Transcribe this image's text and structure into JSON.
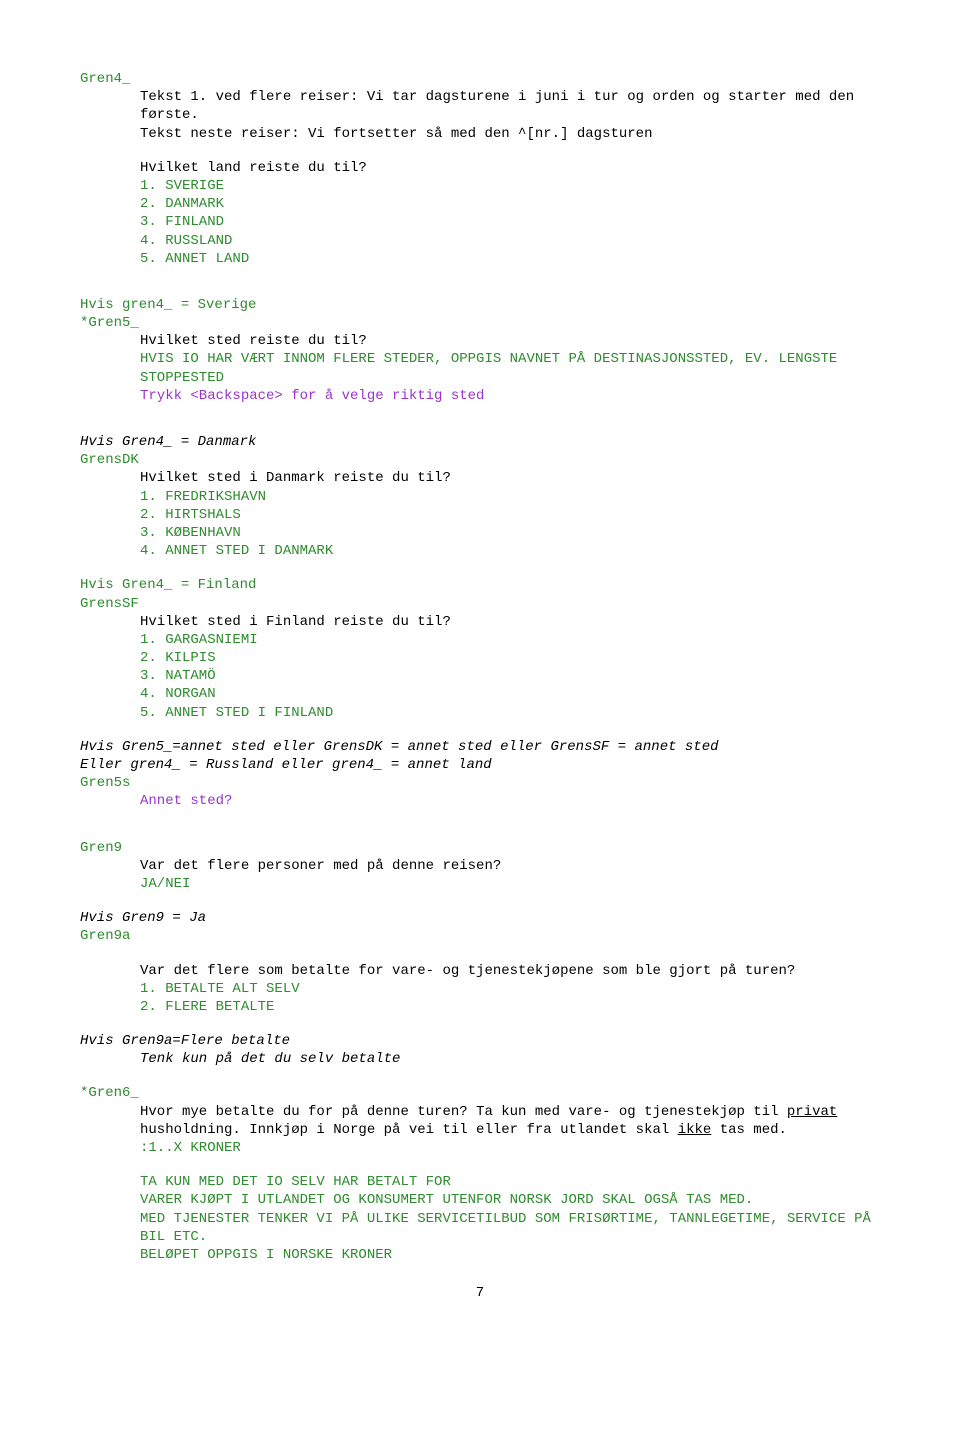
{
  "gren4": {
    "label": "Gren4_",
    "tekst1": "Tekst 1. ved flere reiser: Vi tar dagsturene i juni i tur og orden og starter med den første.",
    "tekst_neste": "Tekst neste reiser: Vi fortsetter så med den ^[nr.] dagsturen",
    "q": "Hvilket land reiste du til?",
    "opts": [
      "1. SVERIGE",
      "2. DANMARK",
      "3. FINLAND",
      "4. RUSSLAND",
      "5. ANNET LAND"
    ]
  },
  "gren5": {
    "cond": "Hvis gren4_ = Sverige",
    "label": "*Gren5_",
    "q": "Hvilket sted reiste du til?",
    "instr1": "HVIS IO HAR VÆRT INNOM FLERE STEDER, OPPGIS NAVNET PÅ DESTINASJONSSTED, EV. LENGSTE STOPPESTED",
    "instr2": "Trykk <Backspace> for å velge riktig sted"
  },
  "grensDK": {
    "cond": "Hvis Gren4_ = Danmark",
    "label": "GrensDK",
    "q": "Hvilket sted i Danmark reiste du til?",
    "opts": [
      "1. FREDRIKSHAVN",
      "2. HIRTSHALS",
      "3. KØBENHAVN",
      "4. ANNET STED I DANMARK"
    ]
  },
  "grensSF": {
    "cond": "Hvis Gren4_ = Finland",
    "label": "GrensSF",
    "q": "Hvilket sted i Finland reiste du til?",
    "opts": [
      "1. GARGASNIEMI",
      "2. KILPIS",
      "3. NATAMÖ",
      "4. NORGAN",
      "5. ANNET STED I FINLAND"
    ]
  },
  "gren5s": {
    "cond1": "Hvis Gren5_=annet sted eller GrensDK = annet sted eller GrensSF = annet sted",
    "cond2": "Eller gren4_ = Russland eller gren4_ = annet land",
    "label": "Gren5s",
    "q": "Annet sted?"
  },
  "gren9": {
    "label": "Gren9",
    "q": "Var det flere personer med på denne reisen?",
    "ans": "JA/NEI"
  },
  "gren9a": {
    "cond": "Hvis Gren9 = Ja",
    "label": "Gren9a",
    "q": "Var det flere som betalte for vare- og tjenestekjøpene som ble gjort på turen?",
    "opts": [
      "1. BETALTE ALT SELV",
      "2. FLERE BETALTE"
    ]
  },
  "gren9a_flere": {
    "cond": "Hvis Gren9a=Flere betalte",
    "txt": "Tenk kun på det du selv betalte"
  },
  "gren6": {
    "label": "*Gren6_",
    "q_p1": "Hvor mye betalte du for på denne turen? Ta kun med vare- og tjenestekjøp til ",
    "q_u1": "privat",
    "q_p2": " husholdning. Innkjøp i Norge på vei til eller fra utlandet skal ",
    "q_u2": "ikke",
    "q_p3": " tas med.",
    "range": ":1..X KRONER",
    "instr": [
      "TA KUN MED DET IO SELV HAR BETALT FOR",
      "VARER KJØPT I UTLANDET OG KONSUMERT UTENFOR NORSK JORD SKAL OGSÅ TAS MED.",
      "MED TJENESTER TENKER VI PÅ ULIKE SERVICETILBUD SOM FRISØRTIME, TANNLEGETIME, SERVICE PÅ BIL ETC.",
      "BELØPET OPPGIS I NORSKE KRONER"
    ]
  },
  "page": "7"
}
